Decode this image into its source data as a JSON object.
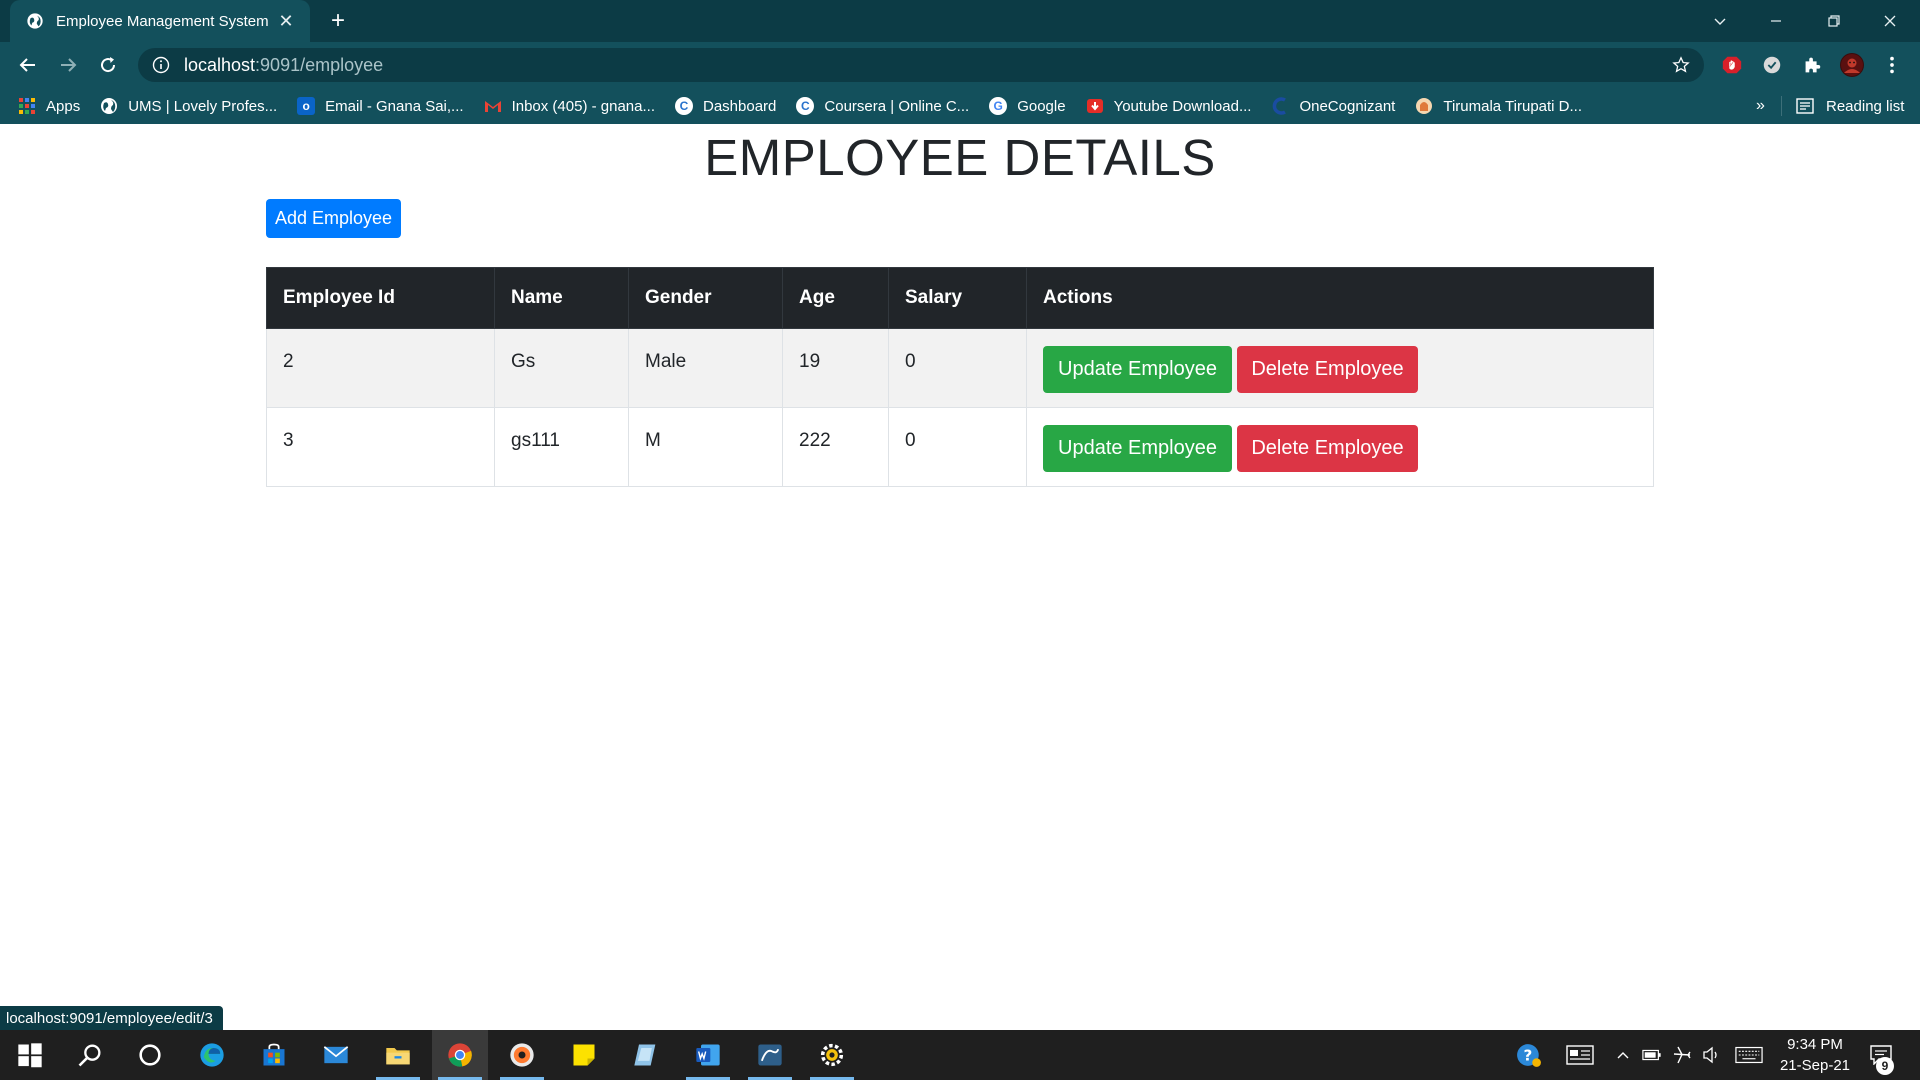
{
  "browser": {
    "tab_title": "Employee Management System",
    "new_tab_glyph": "+",
    "close_glyph": "✕",
    "address_host": "localhost",
    "address_path": ":9091/employee",
    "bookmarks": [
      {
        "label": "Apps",
        "icon": "apps-grid-icon",
        "color": "#ea4335"
      },
      {
        "label": "UMS | Lovely Profes...",
        "icon": "globe-icon",
        "color": "#ffffff"
      },
      {
        "label": "Email - Gnana Sai,...",
        "icon": "outlook-icon",
        "color": "#0a64c8"
      },
      {
        "label": "Inbox (405) - gnana...",
        "icon": "gmail-icon",
        "color": "#ea4335"
      },
      {
        "label": "Dashboard",
        "icon": "coursera-icon",
        "color": "#2a73cc"
      },
      {
        "label": "Coursera | Online C...",
        "icon": "coursera-icon",
        "color": "#2a73cc"
      },
      {
        "label": "Google",
        "icon": "google-icon",
        "color": "#4285f4"
      },
      {
        "label": "Youtube Download...",
        "icon": "youtube-download-icon",
        "color": "#e52d27"
      },
      {
        "label": "OneCognizant",
        "icon": "cognizant-icon",
        "color": "#1a4ca1"
      },
      {
        "label": "Tirumala Tirupati D...",
        "icon": "ttd-icon",
        "color": "#f0b27a"
      }
    ],
    "bookmarks_more": "»",
    "reading_list": "Reading list",
    "status_url": "localhost:9091/employee/edit/3"
  },
  "page": {
    "title": "EMPLOYEE DETAILS",
    "add_button": "Add Employee",
    "columns": [
      "Employee Id",
      "Name",
      "Gender",
      "Age",
      "Salary",
      "Actions"
    ],
    "rows": [
      {
        "id": "2",
        "name": "Gs",
        "gender": "Male",
        "age": "19",
        "salary": "0"
      },
      {
        "id": "3",
        "name": "gs111",
        "gender": "M",
        "age": "222",
        "salary": "0"
      }
    ],
    "update_label": "Update Employee",
    "delete_label": "Delete Employee"
  },
  "taskbar": {
    "time": "9:34 PM",
    "date": "21-Sep-21",
    "notification_count": "9"
  },
  "colors": {
    "primary": "#007bff",
    "success": "#28a745",
    "danger": "#dc3545",
    "table_header": "#212529",
    "chrome_frame": "#0c3b45",
    "chrome_toolbar": "#13505c"
  }
}
